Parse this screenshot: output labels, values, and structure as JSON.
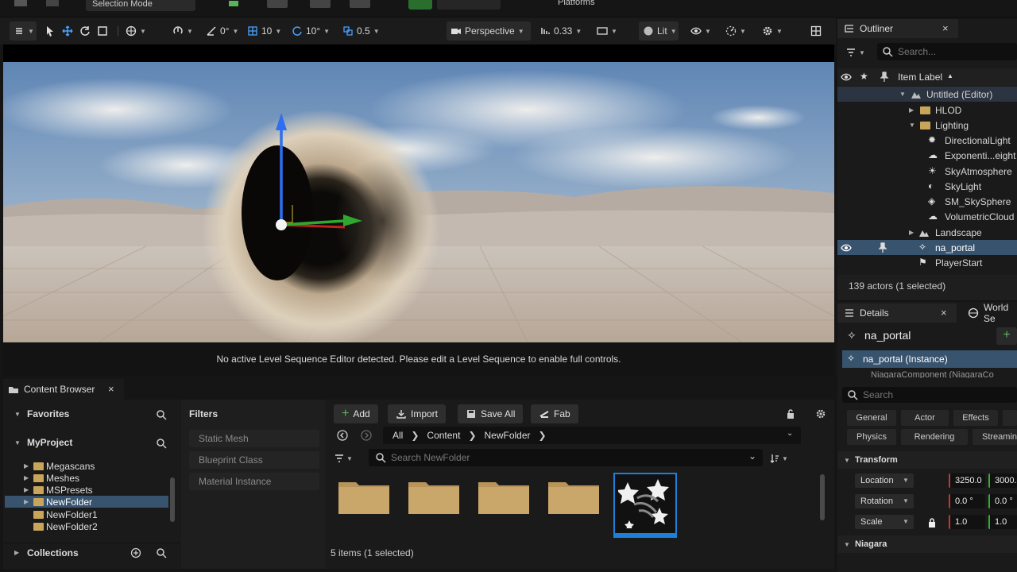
{
  "toolbar": {
    "mode_label": "Selection Mode",
    "platforms_label": "Platforms"
  },
  "viewport_toolbar": {
    "rotate_snap": "0°",
    "grid_snap": "10",
    "angle_snap": "10°",
    "scale_snap": "0.5",
    "view_mode": "Perspective",
    "camera_speed": "0.33",
    "lighting_mode": "Lit"
  },
  "sequencer": {
    "message": "No active Level Sequence Editor detected. Please edit a Level Sequence to enable full controls."
  },
  "outliner": {
    "title": "Outliner",
    "search_placeholder": "Search...",
    "column_label": "Item Label",
    "rows": [
      {
        "label": "Untitled (Editor)",
        "indent": 0
      },
      {
        "label": "HLOD",
        "indent": 1
      },
      {
        "label": "Lighting",
        "indent": 1
      },
      {
        "label": "DirectionalLight",
        "indent": 2
      },
      {
        "label": "Exponenti...eight",
        "indent": 2
      },
      {
        "label": "SkyAtmosphere",
        "indent": 2
      },
      {
        "label": "SkyLight",
        "indent": 2
      },
      {
        "label": "SM_SkySphere",
        "indent": 2
      },
      {
        "label": "VolumetricCloud",
        "indent": 2
      },
      {
        "label": "Landscape",
        "indent": 1
      },
      {
        "label": "na_portal",
        "indent": 1
      },
      {
        "label": "PlayerStart",
        "indent": 1
      }
    ],
    "status": "139 actors (1 selected)"
  },
  "details": {
    "title": "Details",
    "world_tab": "World Se",
    "actor_name": "na_portal",
    "instance_label": "na_portal (Instance)",
    "component_label": "NiagaraComponent (NiagaraCo",
    "search_placeholder": "Search",
    "categories_row1": [
      "General",
      "Actor",
      "Effects"
    ],
    "categories_row2": [
      "Physics",
      "Rendering",
      "Streamin"
    ],
    "transform_header": "Transform",
    "location_label": "Location",
    "location_x": "3250.0",
    "location_y": "3000.0",
    "rotation_label": "Rotation",
    "rotation_x": "0.0 °",
    "rotation_y": "0.0 °",
    "scale_label": "Scale",
    "scale_x": "1.0",
    "scale_y": "1.0",
    "niagara_header": "Niagara"
  },
  "content_browser": {
    "tab_label": "Content Browser",
    "favorites_label": "Favorites",
    "project_label": "MyProject",
    "folders": [
      "Megascans",
      "Meshes",
      "MSPresets",
      "NewFolder",
      "NewFolder1",
      "NewFolder2"
    ],
    "selected_folder": "NewFolder",
    "collections_label": "Collections",
    "filters_label": "Filters",
    "filter_items": [
      "Static Mesh",
      "Blueprint Class",
      "Material Instance"
    ],
    "add_label": "Add",
    "import_label": "Import",
    "save_all_label": "Save All",
    "fab_label": "Fab",
    "path": [
      "All",
      "Content",
      "NewFolder"
    ],
    "search_placeholder": "Search NewFolder",
    "status": "5 items (1 selected)"
  },
  "colors": {
    "selection": "#38536e",
    "folder": "#c9a55a",
    "accent_blue": "#1e7fd8",
    "play_green": "#2a6e2e"
  }
}
